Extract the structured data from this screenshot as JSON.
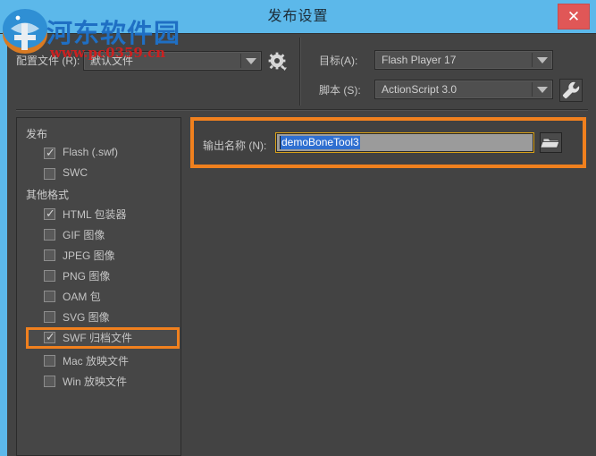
{
  "window": {
    "title": "发布设置",
    "close_label": "✕"
  },
  "colors": {
    "titlebar": "#5cb8ea",
    "close": "#e05757",
    "highlight_orange": "#f0801e",
    "selection_blue": "#2f6fd0",
    "panel_bg": "#434343"
  },
  "watermark": {
    "site_name": "河东软件园",
    "url": "www.pc0359.cn"
  },
  "top": {
    "profile": {
      "label": "配置文件 (R):",
      "value": "默认文件",
      "gear_icon": "gear-icon"
    },
    "target": {
      "label": "目标(A):",
      "value": "Flash Player 17"
    },
    "script": {
      "label": "脚本 (S):",
      "value": "ActionScript 3.0",
      "wrench_icon": "wrench-icon"
    }
  },
  "left_panel": {
    "groups": [
      {
        "title": "发布"
      },
      {
        "title": "其他格式"
      }
    ],
    "items": [
      {
        "label": "Flash (.swf)",
        "checked": true,
        "highlighted": false
      },
      {
        "label": "SWC",
        "checked": false,
        "highlighted": false
      },
      {
        "label": "HTML 包装器",
        "checked": true,
        "highlighted": false
      },
      {
        "label": "GIF 图像",
        "checked": false,
        "highlighted": false
      },
      {
        "label": "JPEG 图像",
        "checked": false,
        "highlighted": false
      },
      {
        "label": "PNG 图像",
        "checked": false,
        "highlighted": false
      },
      {
        "label": "OAM 包",
        "checked": false,
        "highlighted": false
      },
      {
        "label": "SVG 图像",
        "checked": false,
        "highlighted": false
      },
      {
        "label": "SWF 归档文件",
        "checked": true,
        "highlighted": true
      },
      {
        "label": "Mac 放映文件",
        "checked": false,
        "highlighted": false
      },
      {
        "label": "Win 放映文件",
        "checked": false,
        "highlighted": false
      }
    ],
    "tick_glyph": "✓"
  },
  "output": {
    "label": "输出名称 (N):",
    "value": "demoBoneTool3",
    "placeholder": "",
    "browse_icon": "folder-icon"
  }
}
